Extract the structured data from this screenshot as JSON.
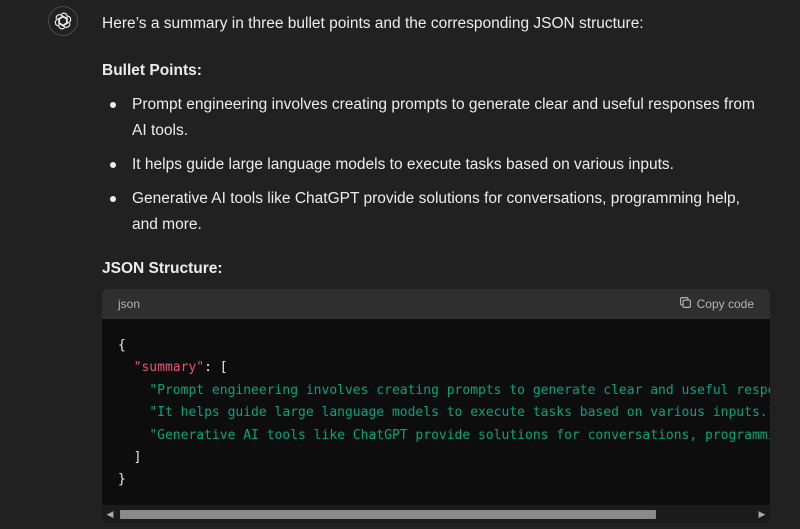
{
  "message": {
    "avatar_icon": "openai-logo-icon",
    "intro": "Here’s a summary in three bullet points and the corresponding JSON structure:",
    "bullets_heading": "Bullet Points:",
    "bullets": [
      "Prompt engineering involves creating prompts to generate clear and useful responses from AI tools.",
      "It helps guide large language models to execute tasks based on various inputs.",
      "Generative AI tools like ChatGPT provide solutions for conversations, programming help, and more."
    ],
    "json_heading": "JSON Structure:"
  },
  "code_block": {
    "language": "json",
    "copy_label": "Copy code",
    "copy_icon": "copy-icon",
    "lines": {
      "open_brace": "{",
      "key": "\"summary\"",
      "key_sep": ": [",
      "item1": "\"Prompt engineering involves creating prompts to generate clear and useful responses from AI tools.\"",
      "item1_sep": ",",
      "item2": "\"It helps guide large language models to execute tasks based on various inputs.\"",
      "item2_sep": ",",
      "item3": "\"Generative AI tools like ChatGPT provide solutions for conversations, programming help, and more.\"",
      "close_bracket": "]",
      "close_brace": "}"
    },
    "scroll_position": 0.0
  },
  "colors": {
    "background": "#212121",
    "text": "#ececec",
    "code_background": "#0d0d0d",
    "code_header": "#2f2f2f",
    "json_key": "#ef4f76",
    "json_string": "#00a67d"
  }
}
